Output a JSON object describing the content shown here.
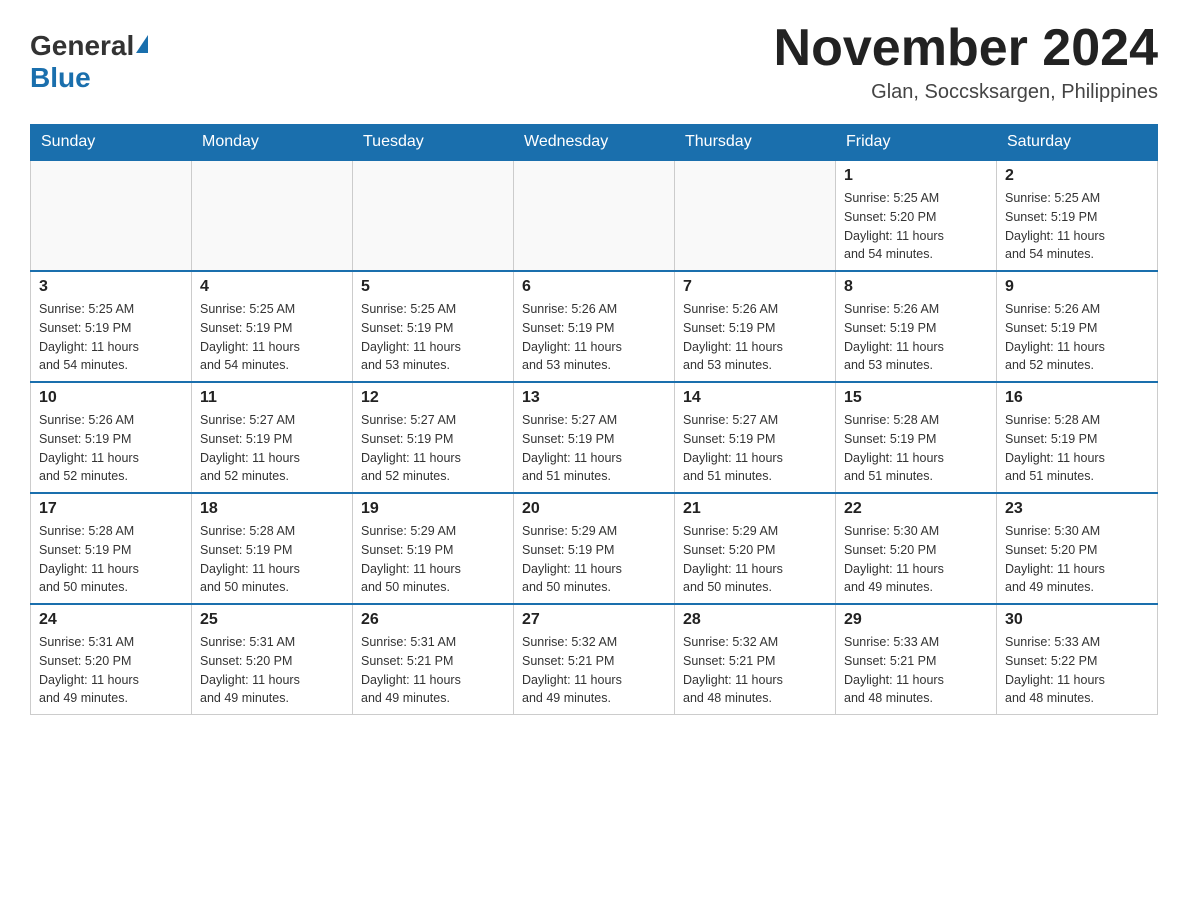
{
  "logo": {
    "general": "General",
    "blue": "Blue"
  },
  "header": {
    "month": "November 2024",
    "location": "Glan, Soccsksargen, Philippines"
  },
  "weekdays": [
    "Sunday",
    "Monday",
    "Tuesday",
    "Wednesday",
    "Thursday",
    "Friday",
    "Saturday"
  ],
  "weeks": [
    [
      {
        "day": "",
        "info": ""
      },
      {
        "day": "",
        "info": ""
      },
      {
        "day": "",
        "info": ""
      },
      {
        "day": "",
        "info": ""
      },
      {
        "day": "",
        "info": ""
      },
      {
        "day": "1",
        "info": "Sunrise: 5:25 AM\nSunset: 5:20 PM\nDaylight: 11 hours\nand 54 minutes."
      },
      {
        "day": "2",
        "info": "Sunrise: 5:25 AM\nSunset: 5:19 PM\nDaylight: 11 hours\nand 54 minutes."
      }
    ],
    [
      {
        "day": "3",
        "info": "Sunrise: 5:25 AM\nSunset: 5:19 PM\nDaylight: 11 hours\nand 54 minutes."
      },
      {
        "day": "4",
        "info": "Sunrise: 5:25 AM\nSunset: 5:19 PM\nDaylight: 11 hours\nand 54 minutes."
      },
      {
        "day": "5",
        "info": "Sunrise: 5:25 AM\nSunset: 5:19 PM\nDaylight: 11 hours\nand 53 minutes."
      },
      {
        "day": "6",
        "info": "Sunrise: 5:26 AM\nSunset: 5:19 PM\nDaylight: 11 hours\nand 53 minutes."
      },
      {
        "day": "7",
        "info": "Sunrise: 5:26 AM\nSunset: 5:19 PM\nDaylight: 11 hours\nand 53 minutes."
      },
      {
        "day": "8",
        "info": "Sunrise: 5:26 AM\nSunset: 5:19 PM\nDaylight: 11 hours\nand 53 minutes."
      },
      {
        "day": "9",
        "info": "Sunrise: 5:26 AM\nSunset: 5:19 PM\nDaylight: 11 hours\nand 52 minutes."
      }
    ],
    [
      {
        "day": "10",
        "info": "Sunrise: 5:26 AM\nSunset: 5:19 PM\nDaylight: 11 hours\nand 52 minutes."
      },
      {
        "day": "11",
        "info": "Sunrise: 5:27 AM\nSunset: 5:19 PM\nDaylight: 11 hours\nand 52 minutes."
      },
      {
        "day": "12",
        "info": "Sunrise: 5:27 AM\nSunset: 5:19 PM\nDaylight: 11 hours\nand 52 minutes."
      },
      {
        "day": "13",
        "info": "Sunrise: 5:27 AM\nSunset: 5:19 PM\nDaylight: 11 hours\nand 51 minutes."
      },
      {
        "day": "14",
        "info": "Sunrise: 5:27 AM\nSunset: 5:19 PM\nDaylight: 11 hours\nand 51 minutes."
      },
      {
        "day": "15",
        "info": "Sunrise: 5:28 AM\nSunset: 5:19 PM\nDaylight: 11 hours\nand 51 minutes."
      },
      {
        "day": "16",
        "info": "Sunrise: 5:28 AM\nSunset: 5:19 PM\nDaylight: 11 hours\nand 51 minutes."
      }
    ],
    [
      {
        "day": "17",
        "info": "Sunrise: 5:28 AM\nSunset: 5:19 PM\nDaylight: 11 hours\nand 50 minutes."
      },
      {
        "day": "18",
        "info": "Sunrise: 5:28 AM\nSunset: 5:19 PM\nDaylight: 11 hours\nand 50 minutes."
      },
      {
        "day": "19",
        "info": "Sunrise: 5:29 AM\nSunset: 5:19 PM\nDaylight: 11 hours\nand 50 minutes."
      },
      {
        "day": "20",
        "info": "Sunrise: 5:29 AM\nSunset: 5:19 PM\nDaylight: 11 hours\nand 50 minutes."
      },
      {
        "day": "21",
        "info": "Sunrise: 5:29 AM\nSunset: 5:20 PM\nDaylight: 11 hours\nand 50 minutes."
      },
      {
        "day": "22",
        "info": "Sunrise: 5:30 AM\nSunset: 5:20 PM\nDaylight: 11 hours\nand 49 minutes."
      },
      {
        "day": "23",
        "info": "Sunrise: 5:30 AM\nSunset: 5:20 PM\nDaylight: 11 hours\nand 49 minutes."
      }
    ],
    [
      {
        "day": "24",
        "info": "Sunrise: 5:31 AM\nSunset: 5:20 PM\nDaylight: 11 hours\nand 49 minutes."
      },
      {
        "day": "25",
        "info": "Sunrise: 5:31 AM\nSunset: 5:20 PM\nDaylight: 11 hours\nand 49 minutes."
      },
      {
        "day": "26",
        "info": "Sunrise: 5:31 AM\nSunset: 5:21 PM\nDaylight: 11 hours\nand 49 minutes."
      },
      {
        "day": "27",
        "info": "Sunrise: 5:32 AM\nSunset: 5:21 PM\nDaylight: 11 hours\nand 49 minutes."
      },
      {
        "day": "28",
        "info": "Sunrise: 5:32 AM\nSunset: 5:21 PM\nDaylight: 11 hours\nand 48 minutes."
      },
      {
        "day": "29",
        "info": "Sunrise: 5:33 AM\nSunset: 5:21 PM\nDaylight: 11 hours\nand 48 minutes."
      },
      {
        "day": "30",
        "info": "Sunrise: 5:33 AM\nSunset: 5:22 PM\nDaylight: 11 hours\nand 48 minutes."
      }
    ]
  ]
}
